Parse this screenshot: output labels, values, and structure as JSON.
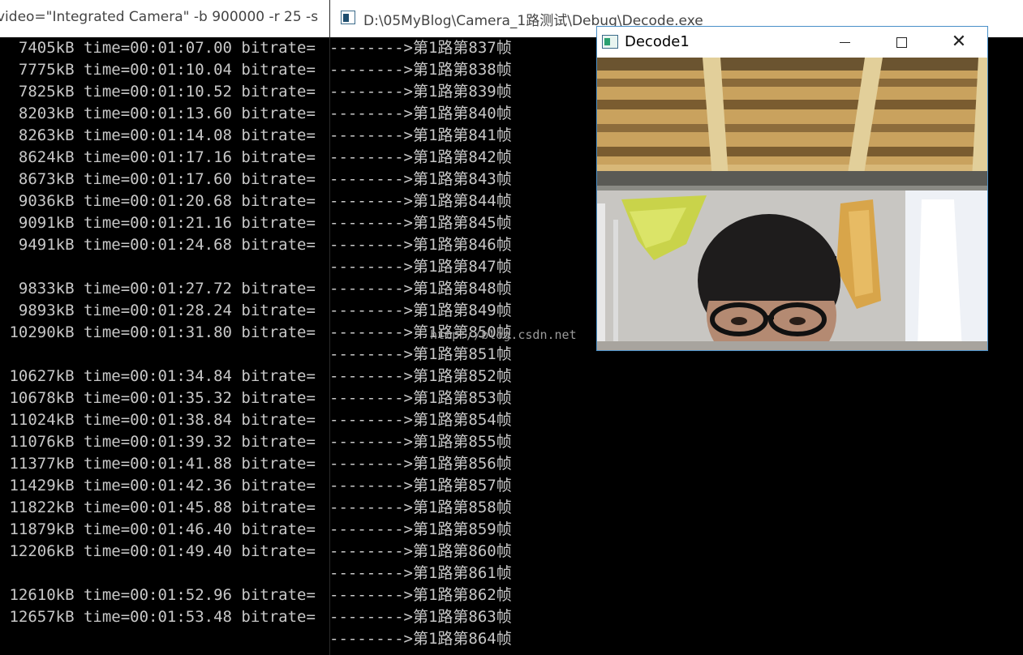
{
  "left_window": {
    "title": "video=\"Integrated Camera\"  -b 900000 -r 25 -s",
    "lines": [
      "  7405kB time=00:01:07.00 bitrate=",
      "  7775kB time=00:01:10.04 bitrate=",
      "  7825kB time=00:01:10.52 bitrate=",
      "  8203kB time=00:01:13.60 bitrate=",
      "  8263kB time=00:01:14.08 bitrate=",
      "  8624kB time=00:01:17.16 bitrate=",
      "  8673kB time=00:01:17.60 bitrate=",
      "  9036kB time=00:01:20.68 bitrate=",
      "  9091kB time=00:01:21.16 bitrate=",
      "  9491kB time=00:01:24.68 bitrate=",
      "",
      "  9833kB time=00:01:27.72 bitrate=",
      "  9893kB time=00:01:28.24 bitrate=",
      " 10290kB time=00:01:31.80 bitrate=",
      "",
      " 10627kB time=00:01:34.84 bitrate=",
      " 10678kB time=00:01:35.32 bitrate=",
      " 11024kB time=00:01:38.84 bitrate=",
      " 11076kB time=00:01:39.32 bitrate=",
      " 11377kB time=00:01:41.88 bitrate=",
      " 11429kB time=00:01:42.36 bitrate=",
      " 11822kB time=00:01:45.88 bitrate=",
      " 11879kB time=00:01:46.40 bitrate=",
      " 12206kB time=00:01:49.40 bitrate=",
      "",
      " 12610kB time=00:01:52.96 bitrate=",
      " 12657kB time=00:01:53.48 bitrate="
    ]
  },
  "right_window": {
    "title": "D:\\05MyBlog\\Camera_1路测试\\Debug\\Decode.exe",
    "lines": [
      "-------->第1路第837帧",
      "-------->第1路第838帧",
      "-------->第1路第839帧",
      "-------->第1路第840帧",
      "-------->第1路第841帧",
      "-------->第1路第842帧",
      "-------->第1路第843帧",
      "-------->第1路第844帧",
      "-------->第1路第845帧",
      "-------->第1路第846帧",
      "-------->第1路第847帧",
      "-------->第1路第848帧",
      "-------->第1路第849帧",
      "-------->第1路第850帧",
      "-------->第1路第851帧",
      "-------->第1路第852帧",
      "-------->第1路第853帧",
      "-------->第1路第854帧",
      "-------->第1路第855帧",
      "-------->第1路第856帧",
      "-------->第1路第857帧",
      "-------->第1路第858帧",
      "-------->第1路第859帧",
      "-------->第1路第860帧",
      "-------->第1路第861帧",
      "-------->第1路第862帧",
      "-------->第1路第863帧",
      "-------->第1路第864帧"
    ],
    "watermark": "http://blog.csdn.net"
  },
  "decode_window": {
    "title": "Decode1",
    "minimize_label": "",
    "maximize_label": "",
    "close_label": "✕"
  },
  "colors": {
    "console_bg": "#000000",
    "console_text": "#c8c8c8",
    "window_border": "#4a90c8"
  },
  "icons": {
    "console_app": "console-app-icon",
    "decode_app": "opencv-window-icon",
    "minimize": "minimize-icon",
    "maximize": "maximize-icon",
    "close": "close-icon"
  }
}
